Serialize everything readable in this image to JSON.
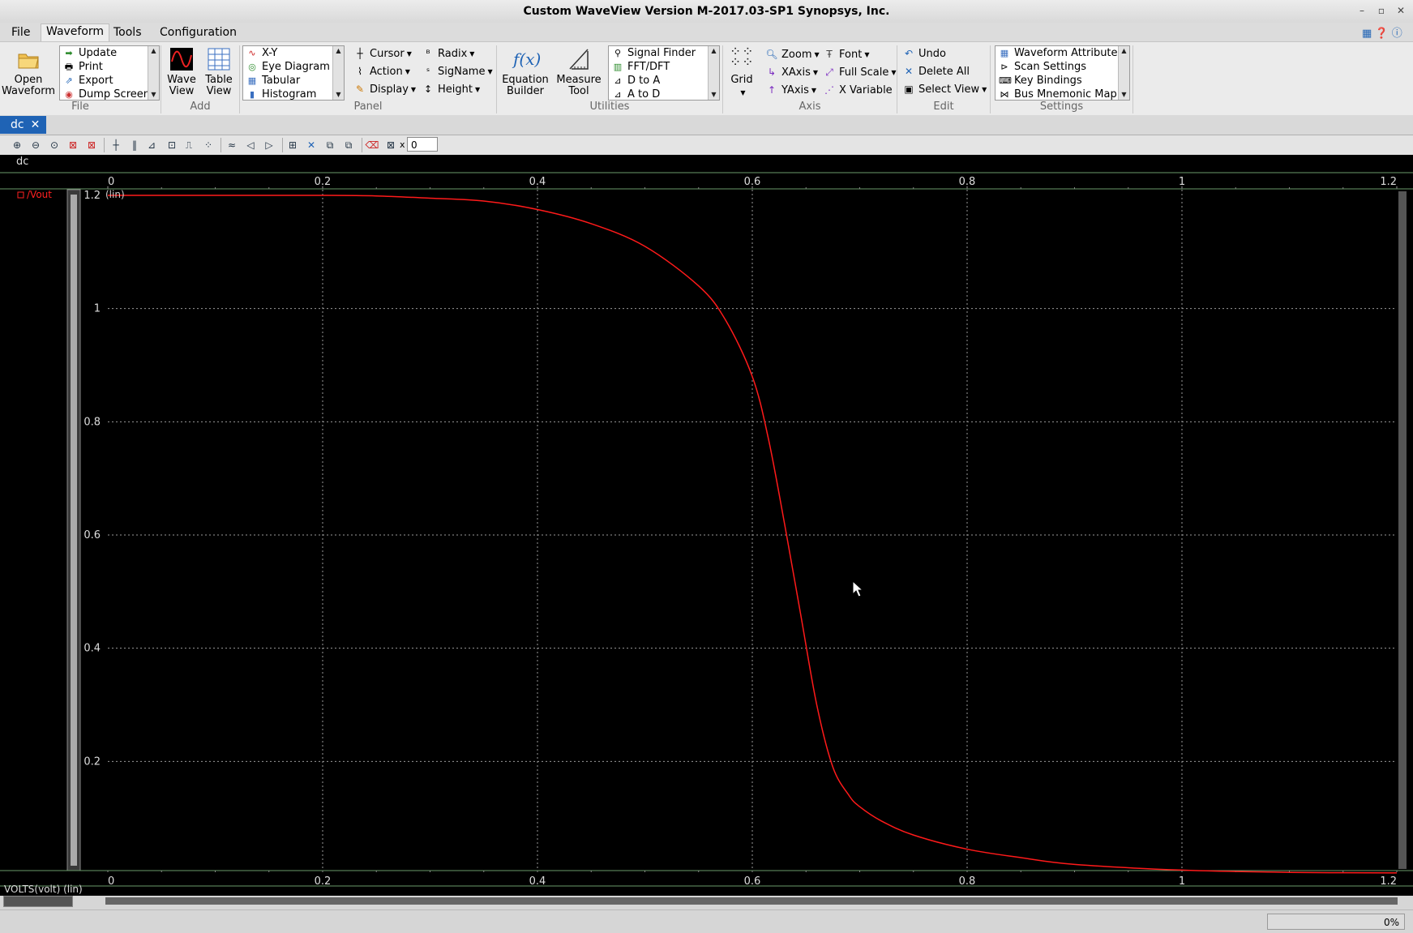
{
  "window": {
    "title": "Custom WaveView Version M-2017.03-SP1 Synopsys, Inc.",
    "controls": [
      "–",
      "▫",
      "✕"
    ]
  },
  "menu": {
    "items": [
      "File",
      "Waveform",
      "Tools",
      "Configuration"
    ],
    "active": "Waveform"
  },
  "ribbon": {
    "file": {
      "open_label": [
        "Open",
        "Waveform"
      ],
      "list": [
        "Update",
        "Print",
        "Export",
        "Dump Screen"
      ],
      "group": "File"
    },
    "add": {
      "wave_label": [
        "Wave",
        "View"
      ],
      "table_label": [
        "Table",
        "View"
      ],
      "group": "Add"
    },
    "panel": {
      "list": [
        "X-Y",
        "Eye Diagram",
        "Tabular",
        "Histogram"
      ],
      "buttons_col1": [
        "Cursor",
        "Action",
        "Display"
      ],
      "buttons_col2": [
        "Radix",
        "SigName",
        "Height"
      ],
      "group": "Panel"
    },
    "utilities": {
      "equation_label": [
        "Equation",
        "Builder"
      ],
      "measure_label": [
        "Measure",
        "Tool"
      ],
      "list": [
        "Signal Finder",
        "FFT/DFT",
        "D to A",
        "A to D"
      ],
      "group": "Utilities"
    },
    "axis": {
      "grid_label": "Grid",
      "col1": [
        "Zoom",
        "XAxis",
        "YAxis"
      ],
      "col2": [
        "Font",
        "Full Scale",
        "X Variable"
      ],
      "group": "Axis"
    },
    "edit": {
      "items": [
        "Undo",
        "Delete All",
        "Select View"
      ],
      "group": "Edit"
    },
    "settings": {
      "list": [
        "Waveform Attributes",
        "Scan Settings",
        "Key Bindings",
        "Bus Mnemonic Map"
      ],
      "group": "Settings"
    }
  },
  "tabs": [
    {
      "label": "dc",
      "close": "✕"
    }
  ],
  "toolbar": {
    "x_input_prefix": "x",
    "x_input_value": "0"
  },
  "panel": {
    "header": "dc",
    "signal_label": "/Vout",
    "y_scale": "(lin)",
    "x_axis_label": "VOLTS(volt) (lin)"
  },
  "status": {
    "progress": "0%"
  },
  "chart_data": {
    "type": "line",
    "title": "",
    "xlabel": "VOLTS(volt) (lin)",
    "ylabel": "",
    "xlim": [
      0,
      1.2
    ],
    "ylim": [
      0,
      1.2
    ],
    "x_ticks": [
      "0",
      "0.2",
      "0.4",
      "0.6",
      "0.8",
      "1",
      "1.2"
    ],
    "y_ticks": [
      "1.2",
      "1",
      "0.8",
      "0.6",
      "0.4",
      "0.2"
    ],
    "grid": true,
    "series": [
      {
        "name": "/Vout",
        "color": "#ff1a1a",
        "x": [
          0,
          0.1,
          0.2,
          0.25,
          0.3,
          0.35,
          0.4,
          0.45,
          0.5,
          0.55,
          0.575,
          0.6,
          0.615,
          0.63,
          0.645,
          0.66,
          0.675,
          0.69,
          0.7,
          0.72,
          0.75,
          0.8,
          0.85,
          0.9,
          1.0,
          1.1,
          1.2
        ],
        "y": [
          1.2,
          1.2,
          1.2,
          1.199,
          1.195,
          1.19,
          1.175,
          1.15,
          1.11,
          1.04,
          0.98,
          0.88,
          0.77,
          0.62,
          0.46,
          0.3,
          0.19,
          0.14,
          0.12,
          0.095,
          0.07,
          0.045,
          0.03,
          0.018,
          0.008,
          0.004,
          0.003
        ]
      }
    ],
    "background": "#000000",
    "grid_color": "#9a9a9a"
  }
}
